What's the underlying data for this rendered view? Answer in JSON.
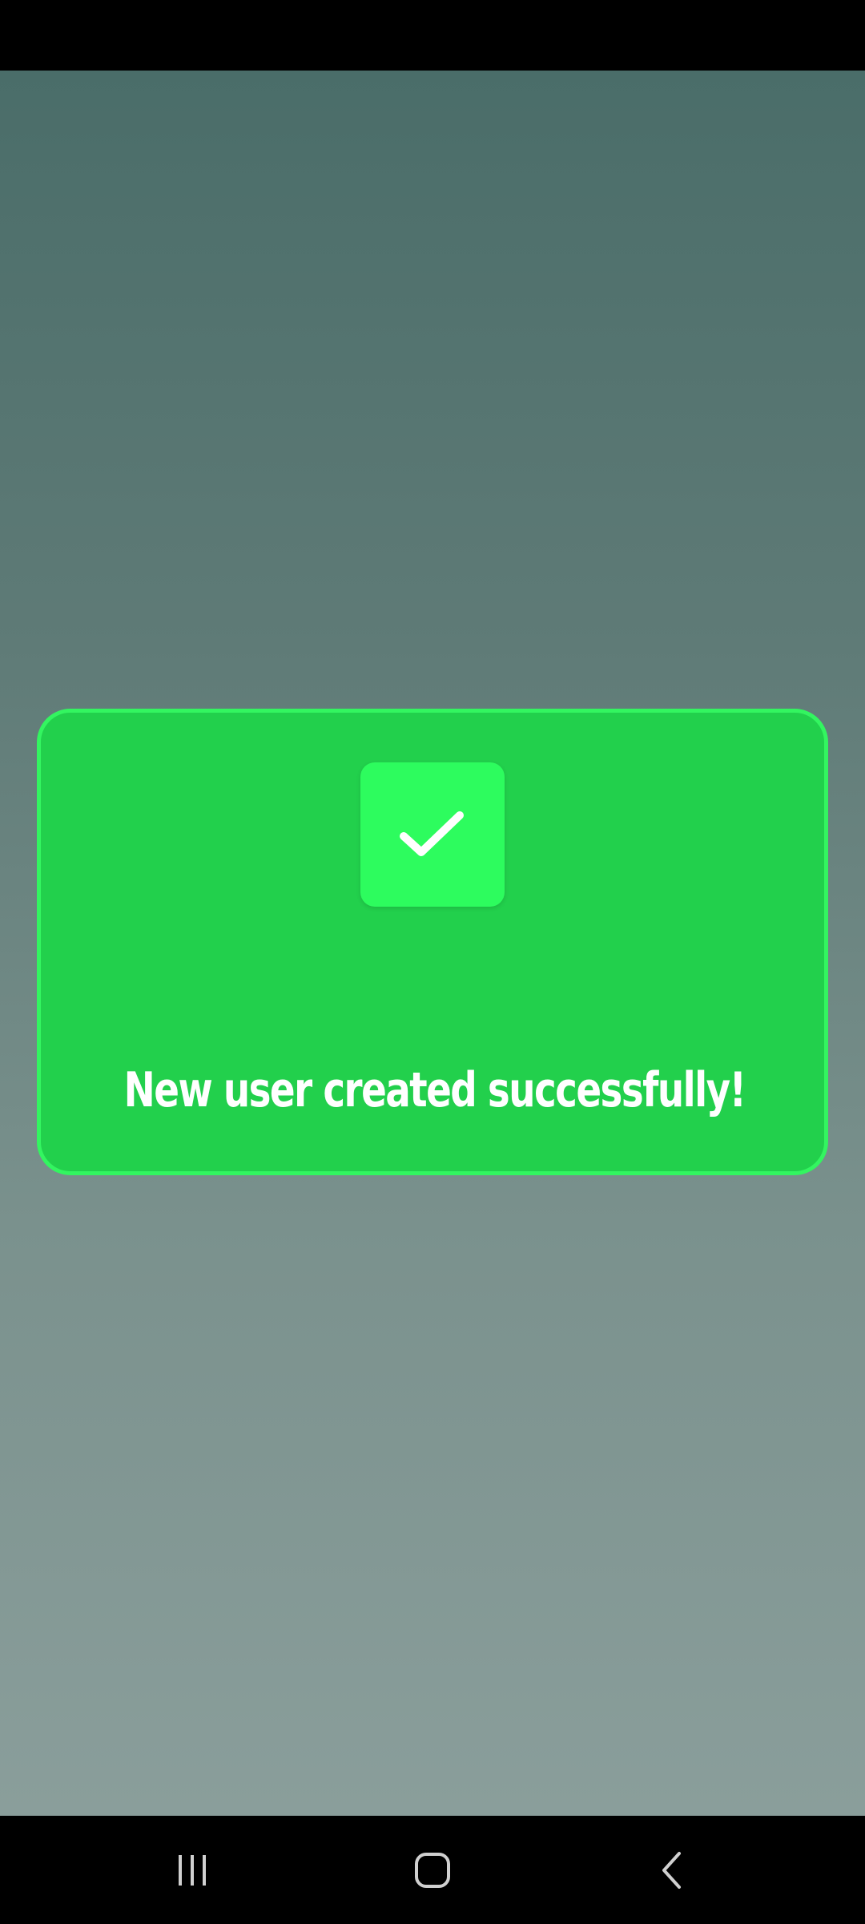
{
  "dialog": {
    "message": "New user created successfully!",
    "icon": "checkmark-icon",
    "background_color": "#22d04c",
    "border_color": "#33f560",
    "icon_tile_color": "#2dfc5e"
  },
  "navigation_bar": {
    "buttons": [
      {
        "icon": "recent-apps-icon"
      },
      {
        "icon": "home-icon"
      },
      {
        "icon": "back-icon"
      }
    ]
  }
}
